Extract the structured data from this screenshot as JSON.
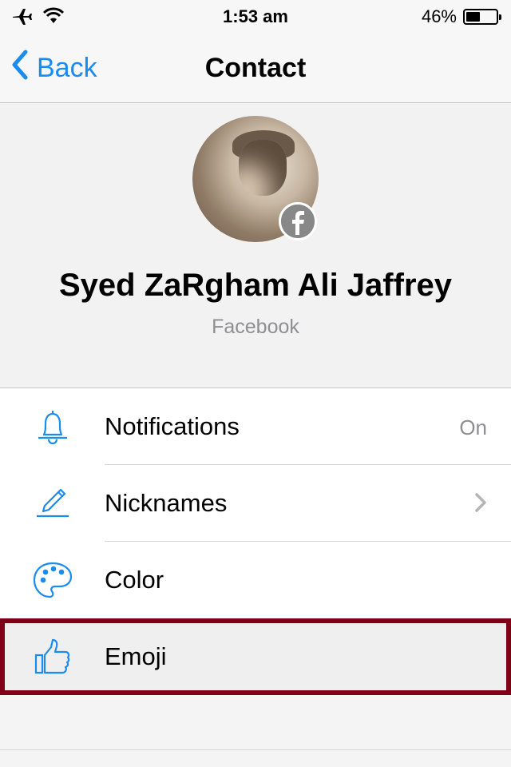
{
  "status_bar": {
    "time": "1:53 am",
    "battery_percent": "46%",
    "battery_level": 0.46,
    "left_icons": [
      "airplane-icon",
      "wifi-icon"
    ]
  },
  "nav": {
    "back_label": "Back",
    "title": "Contact"
  },
  "profile": {
    "name": "Syed ZaRgham Ali Jaffrey",
    "source": "Facebook"
  },
  "menu": {
    "items": [
      {
        "label": "Notifications",
        "value": "On",
        "icon": "bell-icon"
      },
      {
        "label": "Nicknames",
        "icon": "pencil-icon"
      },
      {
        "label": "Color",
        "icon": "palette-icon"
      },
      {
        "label": "Emoji",
        "icon": "thumbs-up-icon",
        "selected": true
      }
    ]
  },
  "colors": {
    "accent": "#1a8cf0",
    "selection_border": "#7d0016",
    "secondary_text": "#8e8e93"
  }
}
